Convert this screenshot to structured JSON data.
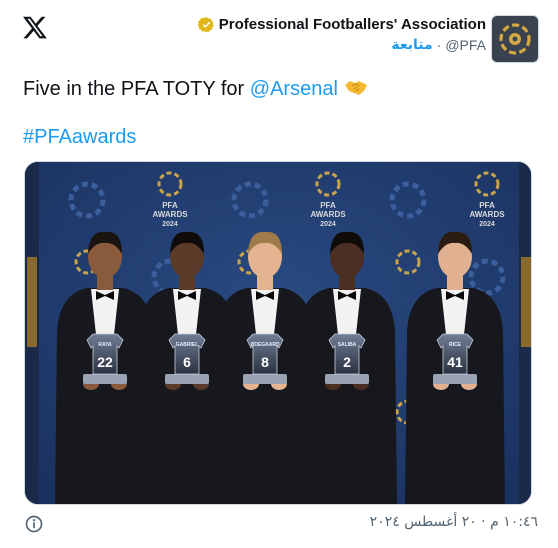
{
  "header": {
    "logo_icon": "x-logo-icon",
    "display_name": "Professional Footballers' Association",
    "verified_icon": "gold-verified-badge-icon",
    "follow_label": "متابعة",
    "separator": "·",
    "handle": "@PFA",
    "avatar_icon": "pfa-logo-icon"
  },
  "tweet": {
    "text_prefix": "Five in the PFA TOTY for ",
    "mention": "@Arsenal",
    "emoji_icon": "handshake-icon",
    "hashtag": "#PFAawards"
  },
  "photo": {
    "backdrop_logo_text_1": "PFA",
    "backdrop_logo_text_2": "AWARDS",
    "backdrop_logo_text_3": "2024",
    "trophies": [
      {
        "name": "RAYA",
        "number": "22"
      },
      {
        "name": "GABRIEL",
        "number": "6"
      },
      {
        "name": "ØDEGAARD",
        "number": "8"
      },
      {
        "name": "SALIBA",
        "number": "2"
      },
      {
        "name": "RICE",
        "number": "41"
      }
    ],
    "colors": {
      "backdrop": "#1f3a6b",
      "suit": "#16181d",
      "shirt": "#f2f2f2",
      "gold": "#c9a449"
    }
  },
  "footer": {
    "info_icon": "info-circle-icon",
    "timestamp": "١٠:٤٦ م · ٢٠ أغسطس ٢٠٢٤"
  },
  "colors": {
    "link": "#1d9bf0",
    "muted": "#536471",
    "text": "#0f1419"
  }
}
